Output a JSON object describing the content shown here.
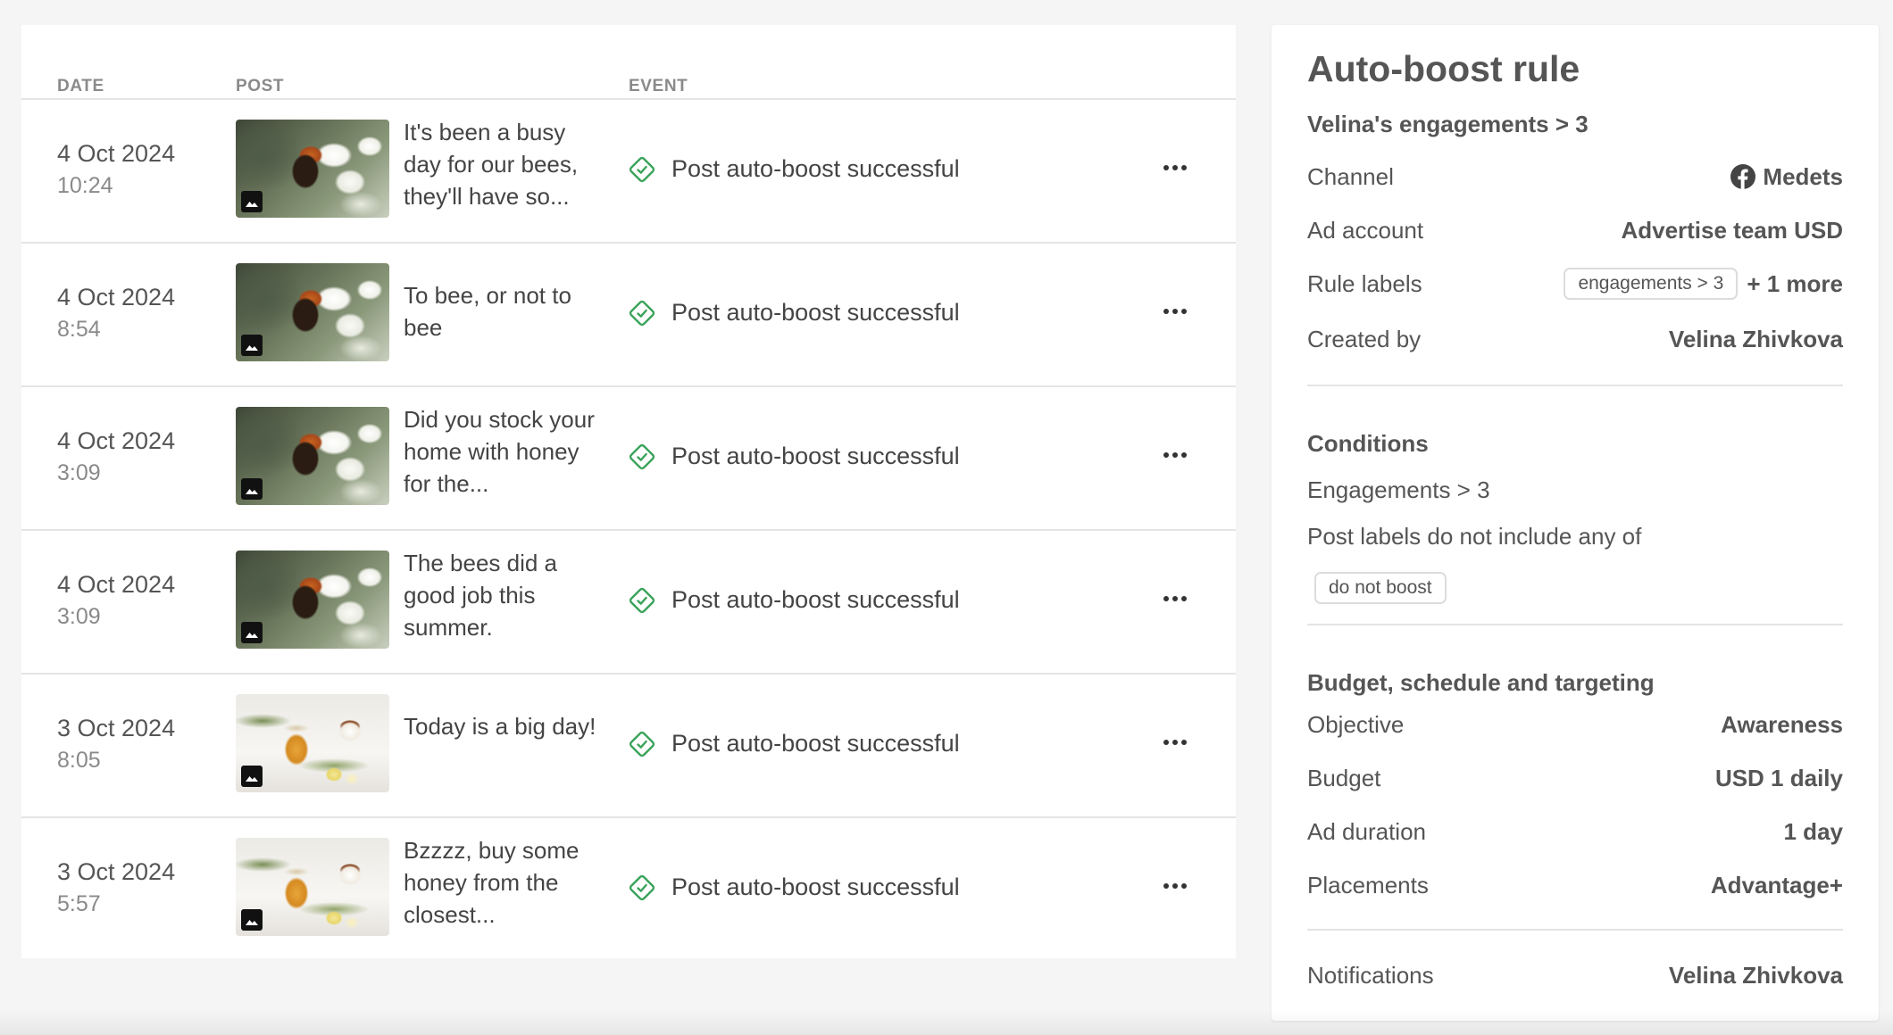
{
  "table": {
    "headers": {
      "date": "DATE",
      "post": "POST",
      "event": "EVENT"
    },
    "rows": [
      {
        "date": "4 Oct 2024",
        "time": "10:24",
        "image": "bee-on-flower",
        "text": "It's been a busy day for our bees, they'll have so...",
        "event": "Post auto-boost successful"
      },
      {
        "date": "4 Oct 2024",
        "time": "8:54",
        "image": "bee-on-flower",
        "text": "To bee, or not to bee",
        "event": "Post auto-boost successful"
      },
      {
        "date": "4 Oct 2024",
        "time": "3:09",
        "image": "bee-on-flower",
        "text": "Did you stock your home with honey for the...",
        "event": "Post auto-boost successful"
      },
      {
        "date": "4 Oct 2024",
        "time": "3:09",
        "image": "bee-on-flower",
        "text": "The bees did a good job this summer.",
        "event": "Post auto-boost successful"
      },
      {
        "date": "3 Oct 2024",
        "time": "8:05",
        "image": "honey-jar-tea",
        "text": "Today is a big day!",
        "event": "Post auto-boost successful"
      },
      {
        "date": "3 Oct 2024",
        "time": "5:57",
        "image": "honey-jar-tea",
        "text": "Bzzzz, buy some honey from the closest...",
        "event": "Post auto-boost successful"
      }
    ]
  },
  "rule": {
    "title": "Auto-boost rule",
    "subtitle": "Velina's engagements > 3",
    "channel_label": "Channel",
    "channel_value": "Medets",
    "channel_icon": "facebook-icon",
    "ad_account_label": "Ad account",
    "ad_account_value": "Advertise team USD",
    "rule_labels_label": "Rule labels",
    "rule_labels_chip": "engagements > 3",
    "rule_labels_more": "+ 1 more",
    "created_by_label": "Created by",
    "created_by_value": "Velina Zhivkova",
    "conditions_title": "Conditions",
    "condition_1": "Engagements > 3",
    "condition_2": "Post labels do not include any of",
    "condition_chip": "do not boost",
    "budget_title": "Budget, schedule and targeting",
    "objective_label": "Objective",
    "objective_value": "Awareness",
    "budget_label": "Budget",
    "budget_value": "USD 1 daily",
    "duration_label": "Ad duration",
    "duration_value": "1 day",
    "placements_label": "Placements",
    "placements_value": "Advantage+",
    "notifications_label": "Notifications",
    "notifications_value": "Velina Zhivkova"
  },
  "colors": {
    "success_green": "#3aa35a",
    "facebook": "#444444"
  }
}
